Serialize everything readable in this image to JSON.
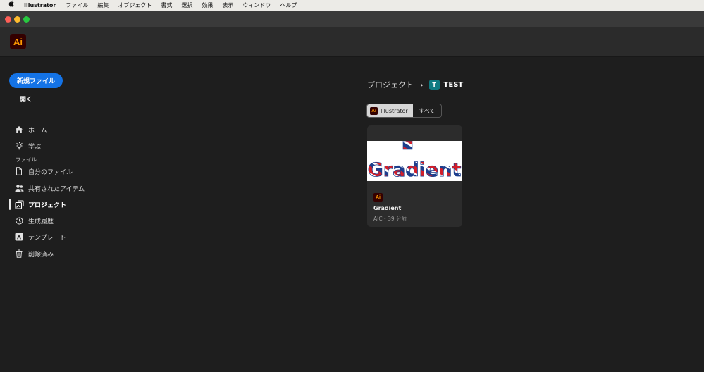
{
  "menubar": {
    "app_name": "Illustrator",
    "items": [
      "ファイル",
      "編集",
      "オブジェクト",
      "書式",
      "選択",
      "効果",
      "表示",
      "ウィンドウ",
      "ヘルプ"
    ]
  },
  "header": {
    "logo_text": "Ai"
  },
  "sidebar": {
    "new_file_label": "新規ファイル",
    "open_label": "開く",
    "files_section": "ファイル",
    "items": [
      {
        "label": "ホーム",
        "icon": "home-icon"
      },
      {
        "label": "学ぶ",
        "icon": "lightbulb-icon"
      },
      {
        "label": "自分のファイル",
        "icon": "document-icon"
      },
      {
        "label": "共有されたアイテム",
        "icon": "people-icon"
      },
      {
        "label": "プロジェクト",
        "icon": "project-icon"
      },
      {
        "label": "生成履歴",
        "icon": "history-icon"
      },
      {
        "label": "テンプレート",
        "icon": "template-icon"
      },
      {
        "label": "削除済み",
        "icon": "trash-icon"
      }
    ],
    "active_item": "プロジェクト"
  },
  "main": {
    "breadcrumb": {
      "root": "プロジェクト",
      "project_initial": "T",
      "project_name": "TEST"
    },
    "filter": {
      "selected": "Illustrator",
      "all": "すべて"
    },
    "cards": [
      {
        "thumb_text": "Gradient",
        "badge": "Ai",
        "title": "Gradient",
        "meta": "AIC・39 分前"
      }
    ]
  },
  "colors": {
    "accent": "#1473e6",
    "ai_orange": "#ff9a00",
    "ai_dark": "#330000",
    "project_teal": "#0f7b82"
  }
}
